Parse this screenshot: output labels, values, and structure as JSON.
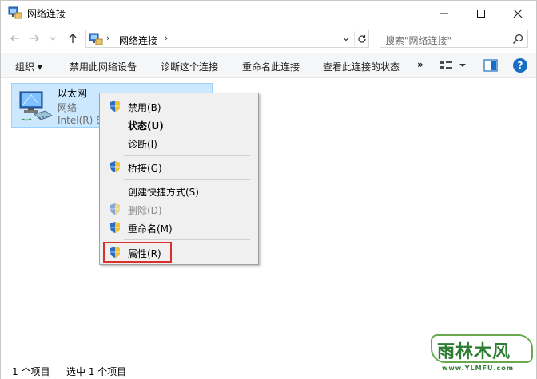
{
  "window": {
    "title": "网络连接"
  },
  "address": {
    "path": "网络连接",
    "search_placeholder": "搜索\"网络连接\""
  },
  "commands": {
    "organize": "组织 ▾",
    "disable": "禁用此网络设备",
    "diagnose": "诊断这个连接",
    "rename": "重命名此连接",
    "status": "查看此连接的状态",
    "more": "»",
    "help": "?"
  },
  "item": {
    "name": "以太网",
    "type": "网络",
    "device": "Intel(R) 8"
  },
  "context_menu": {
    "items": [
      {
        "label": "禁用(B)"
      },
      {
        "label": "状态(U)"
      },
      {
        "label": "诊断(I)"
      },
      {
        "label": "桥接(G)"
      },
      {
        "label": "创建快捷方式(S)"
      },
      {
        "label": "删除(D)"
      },
      {
        "label": "重命名(M)"
      },
      {
        "label": "属性(R)"
      }
    ]
  },
  "status": {
    "count": "1 个项目",
    "selected": "选中 1 个项目"
  },
  "watermark": {
    "text": "雨林木风",
    "url": "www.YLMFU.com"
  },
  "colors": {
    "selection": "#cce8ff",
    "highlight_box": "#d9302c",
    "accent": "#1a6fc4"
  }
}
